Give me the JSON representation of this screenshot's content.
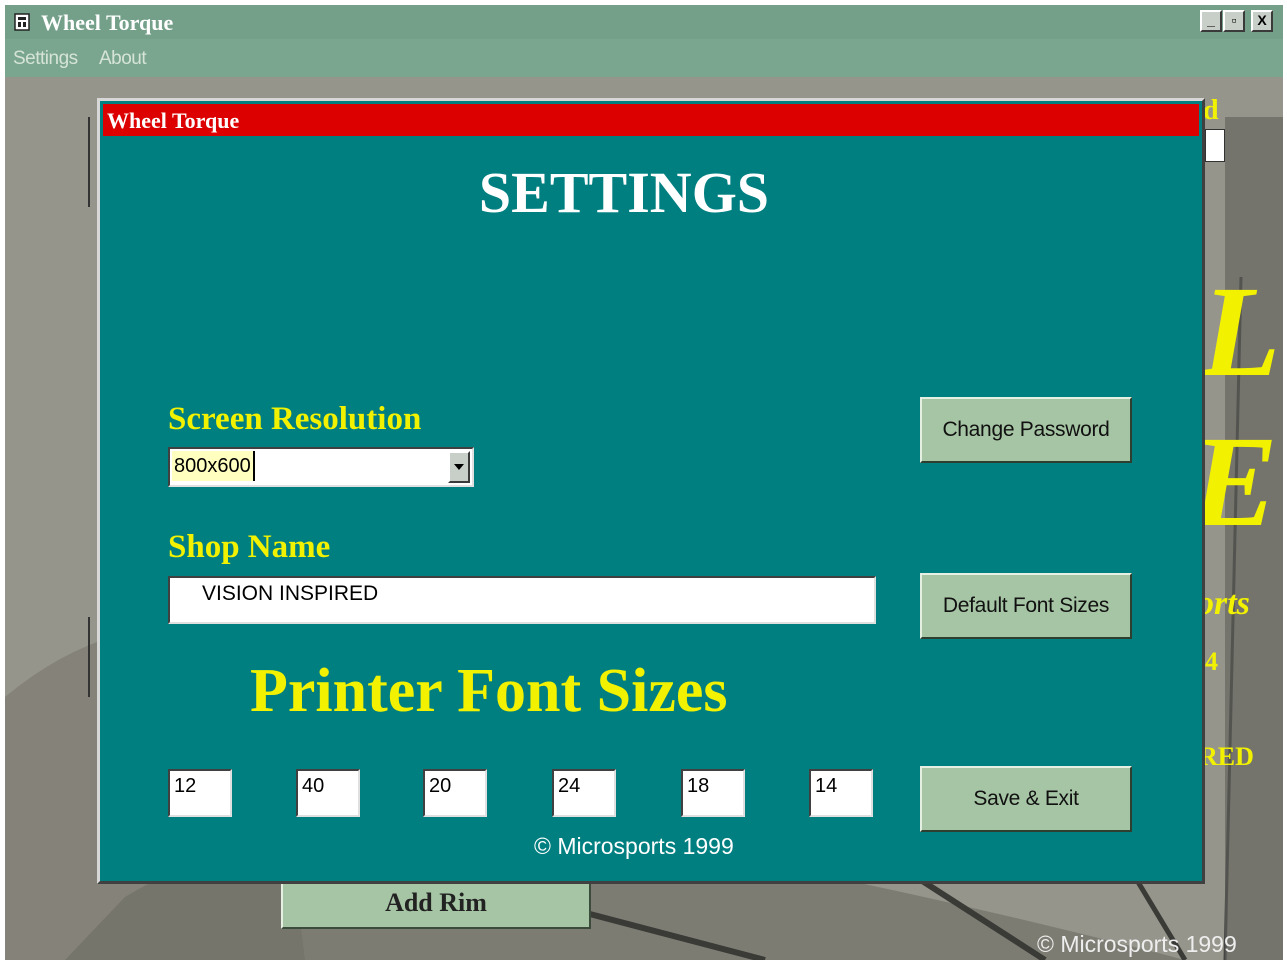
{
  "window": {
    "title": "Wheel Torque",
    "controls": {
      "minimize": "_",
      "restore": "▫",
      "close": "X"
    }
  },
  "menu": {
    "items": [
      {
        "label": "Settings"
      },
      {
        "label": "About"
      }
    ]
  },
  "background": {
    "fragment_d": "d",
    "fragment_big1": "L",
    "fragment_big2": "E",
    "fragment_orts": "orts",
    "fragment_4": "4",
    "fragment_red": "RED",
    "add_rim_label": "Add Rim",
    "copyright": "© Microsports 1999"
  },
  "dialog": {
    "title": "Wheel Torque",
    "heading": "SETTINGS",
    "screen_resolution": {
      "label": "Screen Resolution",
      "value": "800x600"
    },
    "shop_name": {
      "label": "Shop Name",
      "value": "VISION INSPIRED"
    },
    "printer_font_sizes": {
      "label": "Printer Font Sizes",
      "values": [
        "12",
        "40",
        "20",
        "24",
        "18",
        "14"
      ]
    },
    "buttons": {
      "change_password": "Change Password",
      "default_font_sizes": "Default Font Sizes",
      "save_exit": "Save & Exit"
    },
    "copyright": "© Microsports 1999"
  },
  "colors": {
    "dialog_bg": "#007f80",
    "dialog_title_bar": "#dc0000",
    "label_yellow": "#f2f200",
    "button_green": "#a6c5a4",
    "window_green": "#74a08a"
  }
}
